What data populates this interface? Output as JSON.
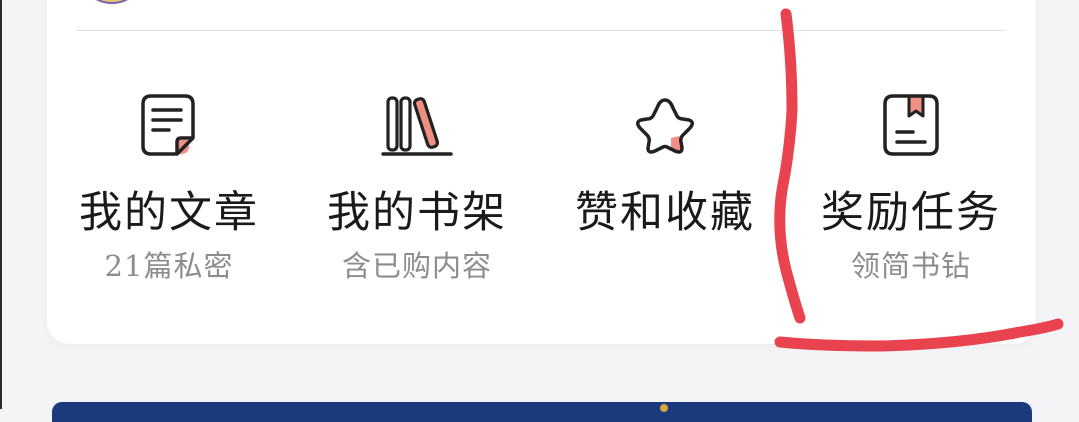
{
  "features": [
    {
      "title": "我的文章",
      "subtitle": "21篇私密",
      "icon": "article-icon"
    },
    {
      "title": "我的书架",
      "subtitle": "含已购内容",
      "icon": "bookshelf-icon"
    },
    {
      "title": "赞和收藏",
      "subtitle": "",
      "icon": "star-icon"
    },
    {
      "title": "奖励任务",
      "subtitle": "领简书钻",
      "icon": "bookmark-book-icon"
    }
  ],
  "colors": {
    "accent": "#f08f84",
    "icon_stroke": "#222222",
    "annotation": "#e8434e",
    "banner": "#1a3a7d"
  }
}
